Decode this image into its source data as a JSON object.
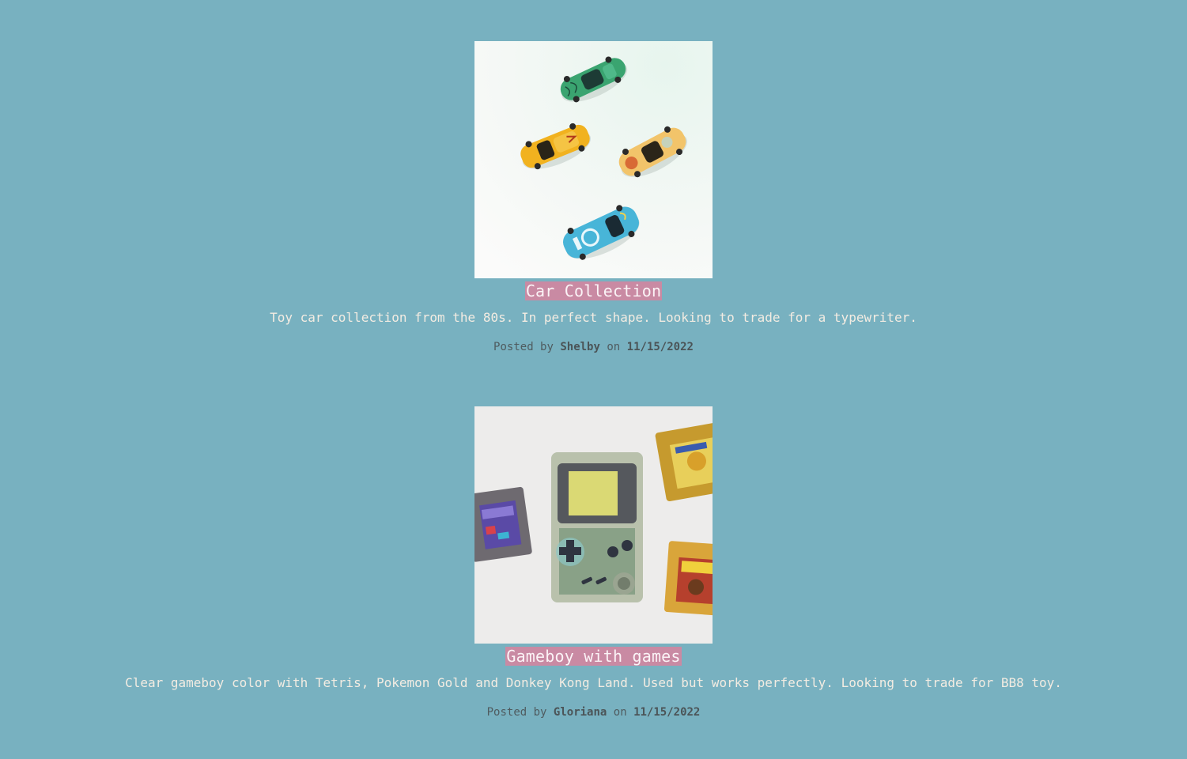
{
  "posts": [
    {
      "image_alt": "toy cars photo",
      "title": "Car Collection",
      "description": "Toy car collection from the 80s. In perfect shape. Looking to trade for a typewriter.",
      "posted_by_prefix": "Posted by",
      "author": "Shelby",
      "on_word": "on",
      "date": "11/15/2022"
    },
    {
      "image_alt": "gameboy with cartridges photo",
      "title": "Gameboy with games",
      "description": "Clear gameboy color with Tetris, Pokemon Gold and Donkey Kong Land. Used but works perfectly. Looking to trade for BB8 toy.",
      "posted_by_prefix": "Posted by",
      "author": "Gloriana",
      "on_word": "on",
      "date": "11/15/2022"
    }
  ],
  "colors": {
    "background": "#78b1c0",
    "title_highlight": "#c98aa3",
    "text": "#f3ece2",
    "meta": "#4f5b5f"
  }
}
